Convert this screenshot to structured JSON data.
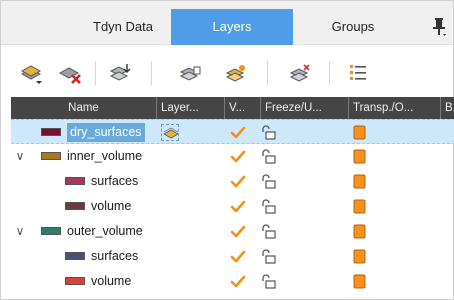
{
  "tabs": [
    {
      "label": "Tdyn Data"
    },
    {
      "label": "Layers"
    },
    {
      "label": "Groups"
    }
  ],
  "pin_symbol": "📌",
  "icons": {
    "toolbar": [
      "new-layer-icon",
      "delete-layer-icon",
      "layer-sort-icon",
      "layer-list-icon",
      "layer-flag-icon",
      "layer-settings-icon",
      "list-view-icon"
    ],
    "row": [
      "layer-to-use-icon",
      "visible-check-icon",
      "freeze-unlock-icon",
      "transparency-icon"
    ]
  },
  "columns": {
    "name": "Name",
    "layer": "Layer...",
    "v": "V...",
    "freeze": "Freeze/U...",
    "transp": "Transp./O...",
    "b": "B..."
  },
  "rows": [
    {
      "label": "dry_surfaces",
      "color": "#7a0f2e",
      "selected": true
    },
    {
      "label": "inner_volume",
      "color": "#a8791c",
      "expanded": true
    },
    {
      "label": "surfaces",
      "color": "#a33a5a"
    },
    {
      "label": "volume",
      "color": "#6b3a3a"
    },
    {
      "label": "outer_volume",
      "color": "#2d7d6c",
      "expanded": true
    },
    {
      "label": "surfaces",
      "color": "#4a4f78"
    },
    {
      "label": "volume",
      "color": "#d9403a"
    }
  ],
  "expander_symbol": "∨",
  "colors": {
    "active_tab": "#4f9de8",
    "header_bg": "#454545",
    "check": "#f0901a",
    "transp": "#f6911d",
    "selected_row": "#cde8fb"
  }
}
